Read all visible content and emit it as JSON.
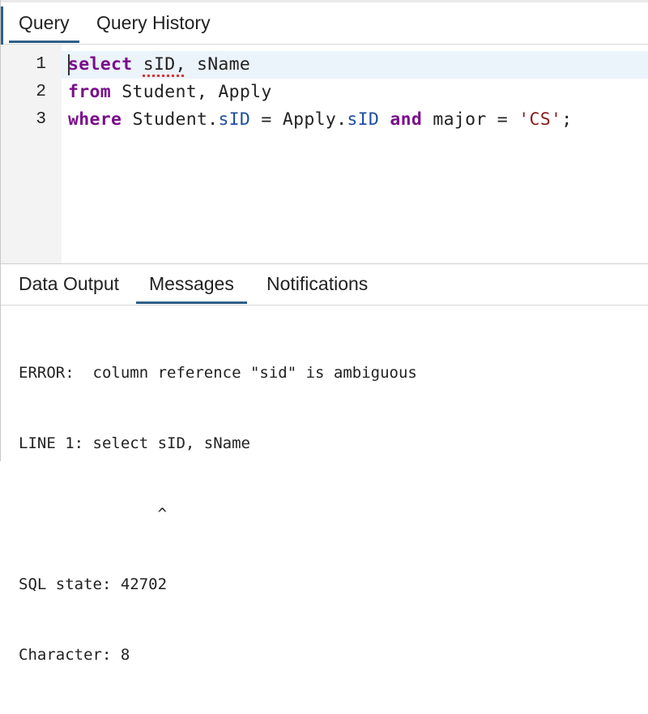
{
  "query_tabs": {
    "items": [
      {
        "label": "Query",
        "active": true
      },
      {
        "label": "Query History",
        "active": false
      }
    ]
  },
  "editor": {
    "line_numbers": [
      "1",
      "2",
      "3"
    ],
    "lines": [
      {
        "tokens": [
          "select",
          " ",
          "sID,",
          " sName"
        ]
      },
      {
        "tokens": [
          "from",
          " Student, Apply"
        ]
      },
      {
        "tokens": [
          "where",
          " Student.",
          "sID",
          " = Apply.",
          "sID",
          " ",
          "and",
          " major = ",
          "'CS'",
          ";"
        ]
      }
    ]
  },
  "result_tabs": {
    "items": [
      {
        "label": "Data Output",
        "active": false
      },
      {
        "label": "Messages",
        "active": true
      },
      {
        "label": "Notifications",
        "active": false
      }
    ]
  },
  "messages": {
    "lines": [
      "ERROR:  column reference \"sid\" is ambiguous",
      "LINE 1: select sID, sName",
      "               ^",
      "SQL state: 42702",
      "Character: 8"
    ]
  },
  "colors": {
    "accent": "#2f5f88",
    "keyword": "#7a0f8a",
    "property": "#1f4fa3",
    "string": "#8b1a1a",
    "gutter": "#f3f3f3",
    "active_line": "#ebf3fb"
  }
}
